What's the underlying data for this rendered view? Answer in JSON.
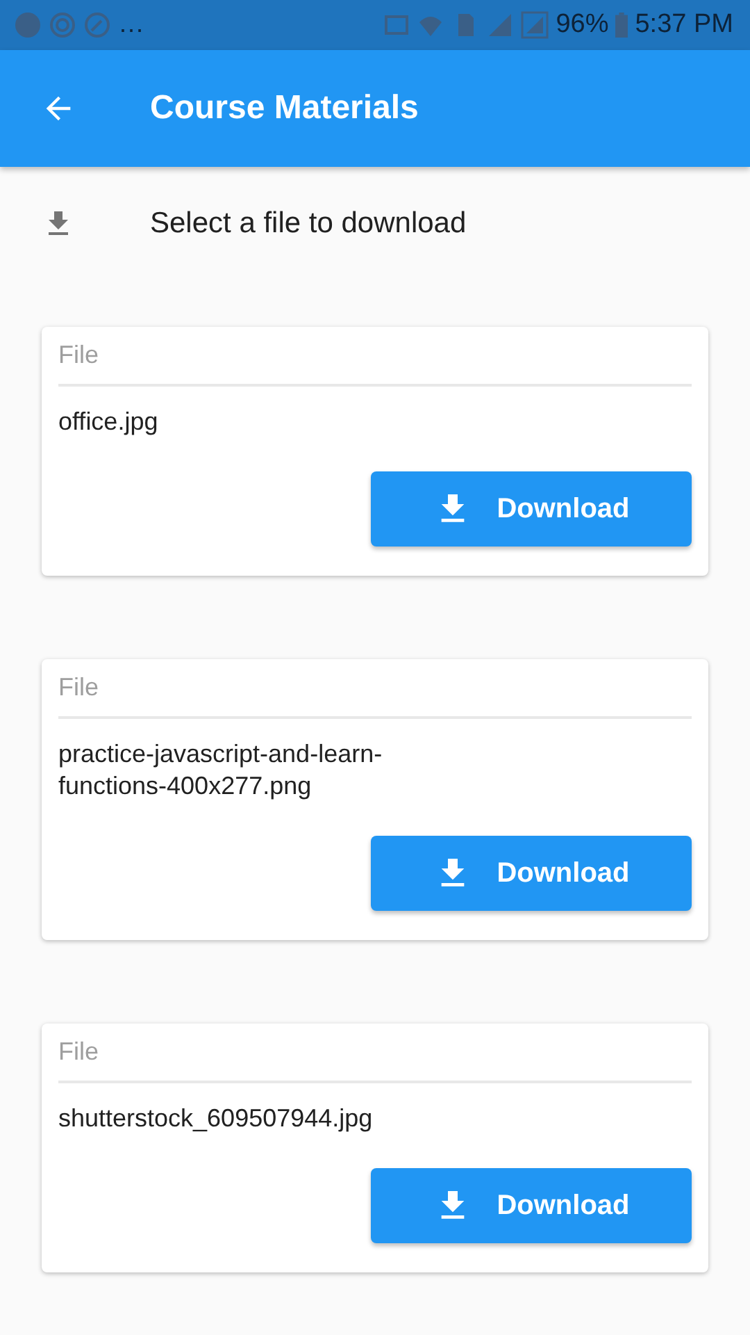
{
  "status_bar": {
    "overflow": "…",
    "battery": "96%",
    "time": "5:37 PM"
  },
  "app_bar": {
    "title": "Course Materials"
  },
  "header": {
    "text": "Select a file to download"
  },
  "files": [
    {
      "label": "File",
      "name": "office.jpg",
      "button": "Download"
    },
    {
      "label": "File",
      "name": "practice-javascript-and-learn-functions-400x277.png",
      "button": "Download"
    },
    {
      "label": "File",
      "name": "shutterstock_609507944.jpg",
      "button": "Download"
    }
  ]
}
